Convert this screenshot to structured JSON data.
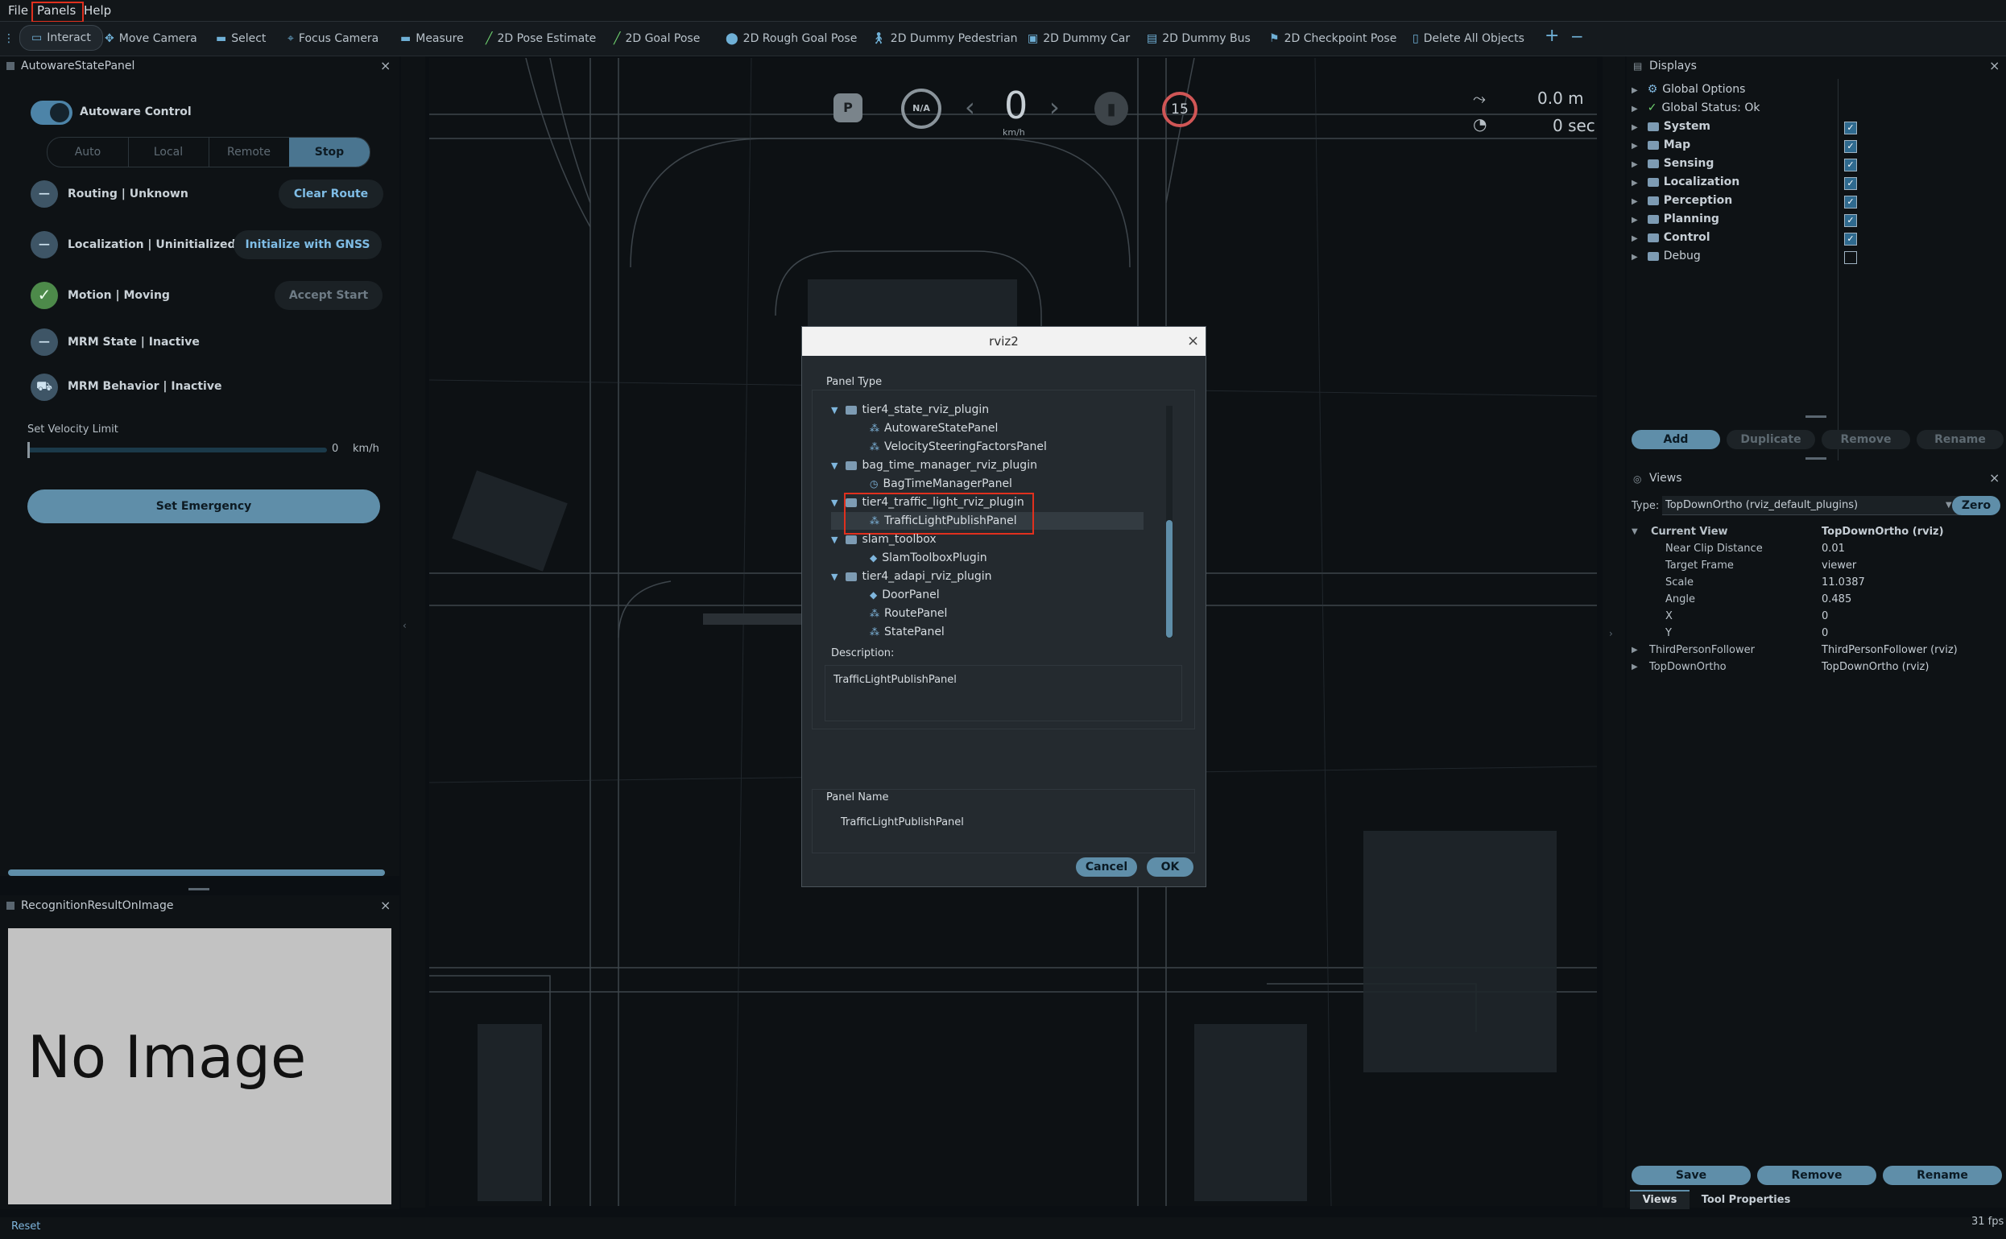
{
  "menubar": {
    "items": [
      "File",
      "Panels",
      "Help"
    ]
  },
  "toolbar": {
    "tools": [
      {
        "label": "Interact",
        "icon": "cursor-icon"
      },
      {
        "label": "Move Camera",
        "icon": "move-icon"
      },
      {
        "label": "Select",
        "icon": "select-icon"
      },
      {
        "label": "Focus Camera",
        "icon": "focus-icon"
      },
      {
        "label": "Measure",
        "icon": "ruler-icon"
      },
      {
        "label": "2D Pose Estimate",
        "icon": "arrow-icon"
      },
      {
        "label": "2D Goal Pose",
        "icon": "arrow-icon"
      },
      {
        "label": "2D Rough Goal Pose",
        "icon": "pin-icon"
      },
      {
        "label": "2D Dummy Pedestrian",
        "icon": "pedestrian-icon"
      },
      {
        "label": "2D Dummy Car",
        "icon": "car-icon"
      },
      {
        "label": "2D Dummy Bus",
        "icon": "bus-icon"
      },
      {
        "label": "2D Checkpoint Pose",
        "icon": "flag-icon"
      },
      {
        "label": "Delete All Objects",
        "icon": "trash-icon"
      }
    ],
    "plus": "+",
    "minus": "−"
  },
  "autoware_panel": {
    "title": "AutowareStatePanel",
    "control_label": "Autoware Control",
    "modes": [
      "Auto",
      "Local",
      "Remote",
      "Stop"
    ],
    "routing": {
      "label": "Routing | Unknown",
      "button": "Clear Route"
    },
    "localization": {
      "label": "Localization | Uninitialized",
      "button": "Initialize with GNSS"
    },
    "motion": {
      "label": "Motion | Moving",
      "button": "Accept Start"
    },
    "mrm_state": {
      "label": "MRM State | Inactive"
    },
    "mrm_behavior": {
      "label": "MRM Behavior | Inactive"
    },
    "velocity_limit_label": "Set Velocity Limit",
    "velocity_value": "0",
    "velocity_unit": "km/h",
    "emergency_button": "Set Emergency"
  },
  "recognition_panel": {
    "title": "RecognitionResultOnImage",
    "no_image_text": "No Image"
  },
  "hud": {
    "gear": "P",
    "steering": "N/A",
    "speed": "0",
    "speed_unit": "km/h",
    "speed_limit": "15",
    "distance": "0.0 m",
    "time": "0 sec"
  },
  "dialog": {
    "title": "rviz2",
    "panel_type_label": "Panel Type",
    "tree": [
      {
        "type": "folder",
        "label": "tier4_state_rviz_plugin"
      },
      {
        "type": "plugin",
        "label": "AutowareStatePanel"
      },
      {
        "type": "plugin",
        "label": "VelocitySteeringFactorsPanel"
      },
      {
        "type": "folder",
        "label": "bag_time_manager_rviz_plugin"
      },
      {
        "type": "plugin",
        "label": "BagTimeManagerPanel"
      },
      {
        "type": "folder",
        "label": "tier4_traffic_light_rviz_plugin"
      },
      {
        "type": "plugin",
        "label": "TrafficLightPublishPanel"
      },
      {
        "type": "folder",
        "label": "slam_toolbox"
      },
      {
        "type": "plugin",
        "label": "SlamToolboxPlugin"
      },
      {
        "type": "folder",
        "label": "tier4_adapi_rviz_plugin"
      },
      {
        "type": "plugin",
        "label": "DoorPanel"
      },
      {
        "type": "plugin",
        "label": "RoutePanel"
      },
      {
        "type": "plugin",
        "label": "StatePanel"
      }
    ],
    "description_label": "Description:",
    "description_text": "TrafficLightPublishPanel",
    "panel_name_label": "Panel Name",
    "panel_name_value": "TrafficLightPublishPanel",
    "cancel": "Cancel",
    "ok": "OK"
  },
  "displays": {
    "title": "Displays",
    "items": [
      {
        "label": "Global Options",
        "checked": null
      },
      {
        "label": "Global Status: Ok",
        "checked": null
      },
      {
        "label": "System",
        "checked": true
      },
      {
        "label": "Map",
        "checked": true
      },
      {
        "label": "Sensing",
        "checked": true
      },
      {
        "label": "Localization",
        "checked": true
      },
      {
        "label": "Perception",
        "checked": true
      },
      {
        "label": "Planning",
        "checked": true
      },
      {
        "label": "Control",
        "checked": true
      },
      {
        "label": "Debug",
        "checked": false
      }
    ],
    "buttons": [
      "Add",
      "Duplicate",
      "Remove",
      "Rename"
    ]
  },
  "views": {
    "title": "Views",
    "type_label": "Type:",
    "type_value": "TopDownOrtho (rviz_default_plugins)",
    "zero_button": "Zero",
    "current_view": {
      "label": "Current View",
      "value": "TopDownOrtho (rviz)"
    },
    "props": [
      {
        "k": "Near Clip Distance",
        "v": "0.01"
      },
      {
        "k": "Target Frame",
        "v": "viewer"
      },
      {
        "k": "Scale",
        "v": "11.0387"
      },
      {
        "k": "Angle",
        "v": "0.485"
      },
      {
        "k": "X",
        "v": "0"
      },
      {
        "k": "Y",
        "v": "0"
      }
    ],
    "saved": [
      {
        "k": "ThirdPersonFollower",
        "v": "ThirdPersonFollower (rviz)"
      },
      {
        "k": "TopDownOrtho",
        "v": "TopDownOrtho (rviz)"
      }
    ],
    "buttons": [
      "Save",
      "Remove",
      "Rename"
    ],
    "tabs": [
      "Views",
      "Tool Properties"
    ]
  },
  "statusbar": {
    "reset": "Reset",
    "fps": "31 fps"
  }
}
